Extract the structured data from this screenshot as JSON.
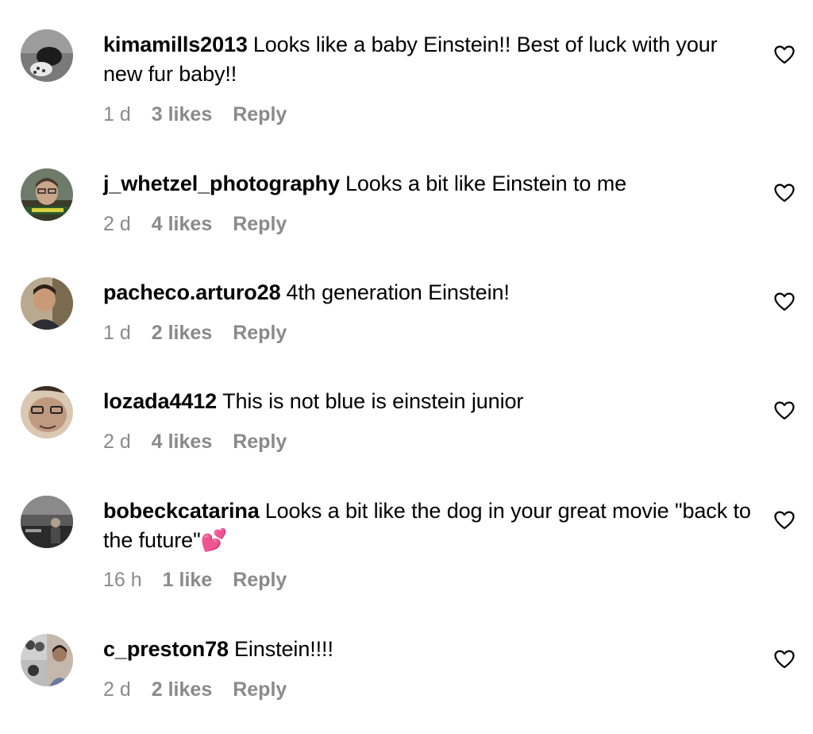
{
  "comments": [
    {
      "username": "kimamills2013",
      "text": "Looks like a baby Einstein!! Best of luck with your new fur baby!!",
      "time": "1 d",
      "likes": "3 likes",
      "reply": "Reply",
      "avatar_icon": "avatar-photo-dog-icon"
    },
    {
      "username": "j_whetzel_photography",
      "text": "Looks a bit like Einstein to me",
      "time": "2 d",
      "likes": "4 likes",
      "reply": "Reply",
      "avatar_icon": "avatar-photo-man-icon"
    },
    {
      "username": "pacheco.arturo28",
      "text": "4th generation Einstein!",
      "time": "1 d",
      "likes": "2 likes",
      "reply": "Reply",
      "avatar_icon": "avatar-photo-man-icon"
    },
    {
      "username": "lozada4412",
      "text": "This is not blue is einstein junior",
      "time": "2 d",
      "likes": "4 likes",
      "reply": "Reply",
      "avatar_icon": "avatar-photo-face-icon"
    },
    {
      "username": "bobeckcatarina",
      "text": "Looks a bit like the dog in your great movie \"back to the future\"💕",
      "time": "16 h",
      "likes": "1 like",
      "reply": "Reply",
      "avatar_icon": "avatar-photo-landscape-icon"
    },
    {
      "username": "c_preston78",
      "text": "Einstein!!!!",
      "time": "2 d",
      "likes": "2 likes",
      "reply": "Reply",
      "avatar_icon": "avatar-photo-collage-icon"
    }
  ],
  "icons": {
    "like": "heart-outline-icon"
  },
  "colors": {
    "text": "#000000",
    "meta": "#8a8a8a",
    "background": "#ffffff"
  }
}
